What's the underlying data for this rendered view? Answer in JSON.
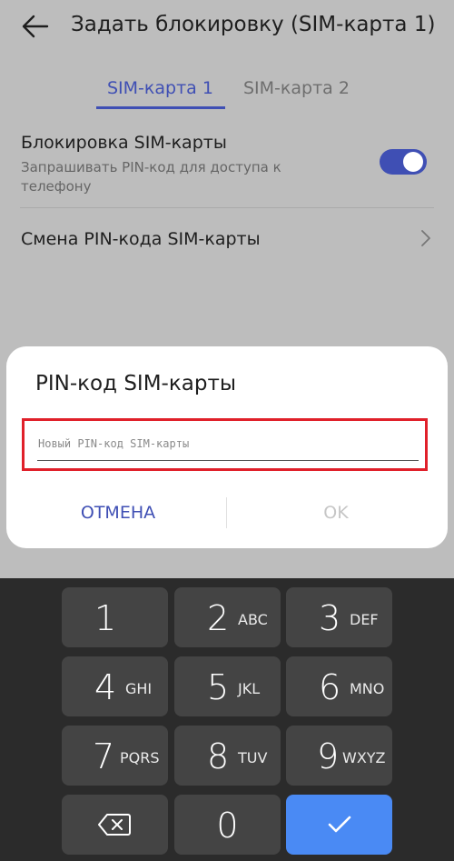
{
  "header": {
    "title": "Задать блокировку (SIM-карта 1)",
    "back_icon": "arrow-left-icon"
  },
  "tabs": [
    {
      "label": "SIM-карта 1",
      "active": true
    },
    {
      "label": "SIM-карта 2",
      "active": false
    }
  ],
  "settings": {
    "sim_lock": {
      "title": "Блокировка SIM-карты",
      "subtitle": "Запрашивать PIN-код для доступа к телефону",
      "enabled": true
    },
    "change_pin": {
      "title": "Смена PIN-кода SIM-карты"
    }
  },
  "dialog": {
    "title": "PIN-код SIM-карты",
    "input_placeholder": "Новый PIN-код SIM-карты",
    "input_value": "",
    "cancel_label": "ОТМЕНА",
    "ok_label": "OK"
  },
  "keyboard": {
    "keys": [
      {
        "num": "1",
        "letters": ""
      },
      {
        "num": "2",
        "letters": "ABC"
      },
      {
        "num": "3",
        "letters": "DEF"
      },
      {
        "num": "4",
        "letters": "GHI"
      },
      {
        "num": "5",
        "letters": "JKL"
      },
      {
        "num": "6",
        "letters": "MNO"
      },
      {
        "num": "7",
        "letters": "PQRS"
      },
      {
        "num": "8",
        "letters": "TUV"
      },
      {
        "num": "9",
        "letters": "WXYZ"
      },
      {
        "num": "0",
        "letters": ""
      }
    ],
    "backspace_icon": "backspace-icon",
    "done_icon": "checkmark-icon"
  },
  "colors": {
    "accent": "#3f4fb4",
    "highlight": "#e0202a",
    "done_key": "#4a8af4",
    "keyboard_bg": "#2b2b2b",
    "key_bg": "#444444"
  }
}
